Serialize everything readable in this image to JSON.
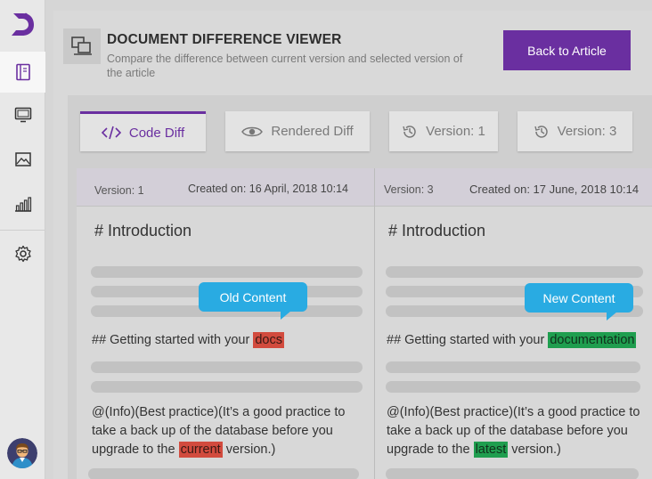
{
  "header": {
    "title": "DOCUMENT DIFFERENCE VIEWER",
    "subtitle": "Compare the difference between current version and selected version of the article",
    "back_label": "Back to Article"
  },
  "sidebar": {
    "items": [
      {
        "name": "articles",
        "icon": "book-icon"
      },
      {
        "name": "screens",
        "icon": "monitor-icon"
      },
      {
        "name": "images",
        "icon": "image-icon"
      },
      {
        "name": "reports",
        "icon": "bar-chart-icon"
      },
      {
        "name": "settings",
        "icon": "gear-icon"
      }
    ]
  },
  "tabs": [
    {
      "label": "Code Diff",
      "icon": "code-icon",
      "active": true
    },
    {
      "label": "Rendered Diff",
      "icon": "eye-icon",
      "active": false
    },
    {
      "label": "Version: 1",
      "icon": "history-icon",
      "active": false
    },
    {
      "label": "Version: 3",
      "icon": "history-icon",
      "active": false
    }
  ],
  "left_pane": {
    "version": "Version: 1",
    "created": "Created on: 16 April, 2018 10:14",
    "heading": "# Introduction",
    "bubble": "Old Content",
    "line_prefix": "## Getting started with your ",
    "line_highlight": "docs",
    "para_text_1": "@(Info)(Best practice)(It’s a good practice to take a back up of the database before you upgrade to the ",
    "para_highlight": "current",
    "para_text_2": " version.)"
  },
  "right_pane": {
    "version": "Version: 3",
    "created": "Created on: 17 June, 2018 10:14",
    "heading": "# Introduction",
    "bubble": "New Content",
    "line_prefix": "## Getting started with your ",
    "line_highlight": "documentation",
    "para_text_1": "@(Info)(Best practice)(It’s a good practice to take a back up of the database before you upgrade to the ",
    "para_highlight": "latest",
    "para_text_2": " version.)"
  },
  "colors": {
    "accent": "#6a2fa0",
    "bubble": "#29abe2",
    "removed": "#d24b3e",
    "added": "#1f9e4f"
  }
}
